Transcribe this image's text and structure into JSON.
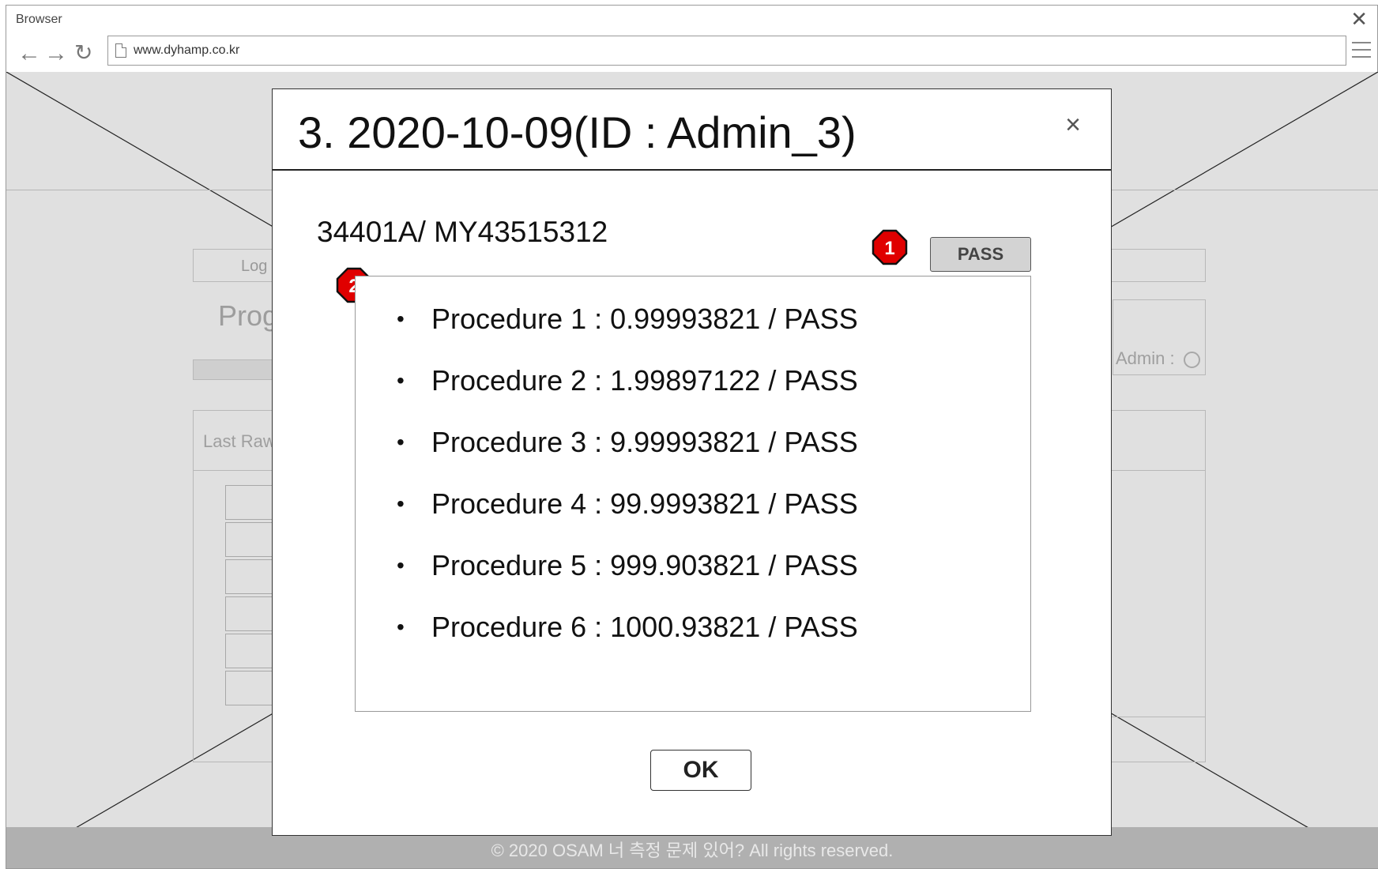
{
  "browser": {
    "title": "Browser",
    "close_glyph": "✕",
    "back_glyph": "←",
    "forward_glyph": "→",
    "reload_glyph": "↻",
    "url": "www.dyhamp.co.kr",
    "icons": [
      "back-arrow-icon",
      "forward-arrow-icon",
      "reload-icon",
      "document-icon",
      "hamburger-menu-icon",
      "close-icon"
    ]
  },
  "background_page": {
    "tab_label": "Log",
    "progress_title": "Prog",
    "admin_label": "Admin :",
    "box_label": "Last Raw",
    "footer_text": "© 2020 OSAM 너 측정 문제 있어? All rights reserved."
  },
  "modal": {
    "title": "3. 2020-10-09(ID : Admin_3)",
    "close_glyph": "×",
    "serial": "34401A/ MY43515312",
    "pass_label": "PASS",
    "ok_label": "OK",
    "markers": [
      "1",
      "2"
    ],
    "bullet_glyph": "•",
    "procedures": [
      "Procedure 1 : 0.99993821 / PASS",
      "Procedure 2 : 1.99897122 / PASS",
      "Procedure 3 : 9.99993821 / PASS",
      "Procedure 4 : 99.9993821 / PASS",
      "Procedure 5 : 999.903821 / PASS",
      "Procedure 6 : 1000.93821 / PASS"
    ]
  },
  "colors": {
    "marker_fill": "#e00000",
    "marker_stroke": "#111111",
    "overlay_background": "#e0e0e0",
    "footer_background": "#b0b0b0",
    "pass_button_fill": "#d3d3d3"
  }
}
